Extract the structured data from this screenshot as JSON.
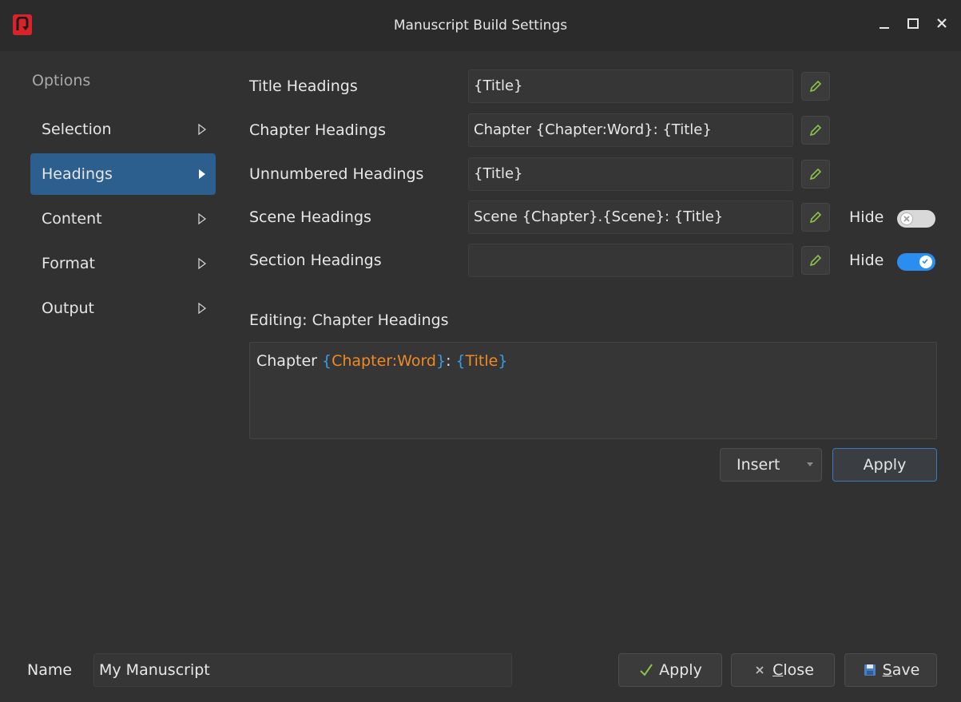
{
  "window": {
    "title": "Manuscript Build Settings",
    "app_icon": "novelwriter-logo-icon"
  },
  "sidebar": {
    "header": "Options",
    "items": [
      {
        "label": "Selection",
        "active": false
      },
      {
        "label": "Headings",
        "active": true
      },
      {
        "label": "Content",
        "active": false
      },
      {
        "label": "Format",
        "active": false
      },
      {
        "label": "Output",
        "active": false
      }
    ]
  },
  "headings": {
    "rows": [
      {
        "label": "Title Headings",
        "value": "{Title}"
      },
      {
        "label": "Chapter Headings",
        "value": "Chapter {Chapter:Word}: {Title}"
      },
      {
        "label": "Unnumbered Headings",
        "value": "{Title}"
      },
      {
        "label": "Scene Headings",
        "value": "Scene {Chapter}.{Scene}: {Title}",
        "hide_label": "Hide",
        "hide": false
      },
      {
        "label": "Section Headings",
        "value": "",
        "hide_label": "Hide",
        "hide": true
      }
    ]
  },
  "editor": {
    "label": "Editing: Chapter Headings",
    "text_prefix": "Chapter ",
    "token1_open": "{",
    "token1": "Chapter:Word",
    "token1_close": "}",
    "sep": ": ",
    "token2_open": "{",
    "token2": "Title",
    "token2_close": "}",
    "insert_label": "Insert",
    "apply_label": "Apply"
  },
  "footer": {
    "name_label": "Name",
    "name_value": "My Manuscript",
    "apply_label": "Apply",
    "close_label": "Close",
    "save_label": "Save"
  },
  "colors": {
    "accent": "#2d5f8e",
    "toggle_on": "#2a8ef0",
    "token": "#f08a24",
    "brace": "#3b9be0",
    "edit_icon": "#8bc34a"
  }
}
